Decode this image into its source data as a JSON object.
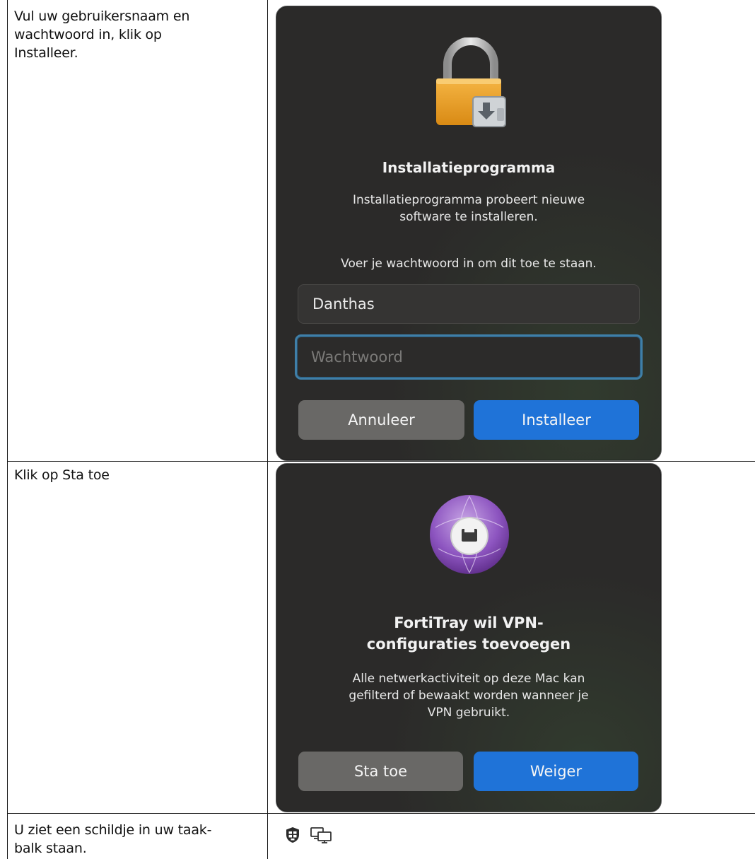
{
  "rows": [
    {
      "instruction": [
        "Vul uw gebruikersnaam en",
        "wachtwoord in, klik op",
        "Installeer."
      ],
      "dialog": {
        "icon": "lock-installer-icon",
        "title": "Installatieprogramma",
        "message": [
          "Installatieprogramma probeert nieuwe",
          "software te installeren."
        ],
        "prompt": "Voer je wachtwoord in om dit toe te staan.",
        "username_value": "Danthas",
        "password_placeholder": "Wachtwoord",
        "cancel_label": "Annuleer",
        "confirm_label": "Installeer"
      }
    },
    {
      "instruction": [
        "Klik op Sta toe"
      ],
      "dialog": {
        "icon": "network-ethernet-icon",
        "title": [
          "FortiTray wil VPN-",
          "configuraties toevoegen"
        ],
        "message": [
          "Alle netwerkactiviteit op deze Mac kan",
          "gefilterd of bewaakt worden wanneer je",
          "VPN gebruikt."
        ],
        "allow_label": "Sta toe",
        "deny_label": "Weiger"
      }
    },
    {
      "instruction": [
        "U ziet een schildje in uw taak-",
        "balk staan."
      ],
      "tray_icons": [
        "forticlient-shield-icon",
        "remote-display-icon"
      ]
    }
  ],
  "colors": {
    "dialog_bg": "#2b2a29",
    "primary_button": "#1f73d8",
    "secondary_button": "#696866",
    "focus_ring": "#3f7fa8"
  }
}
